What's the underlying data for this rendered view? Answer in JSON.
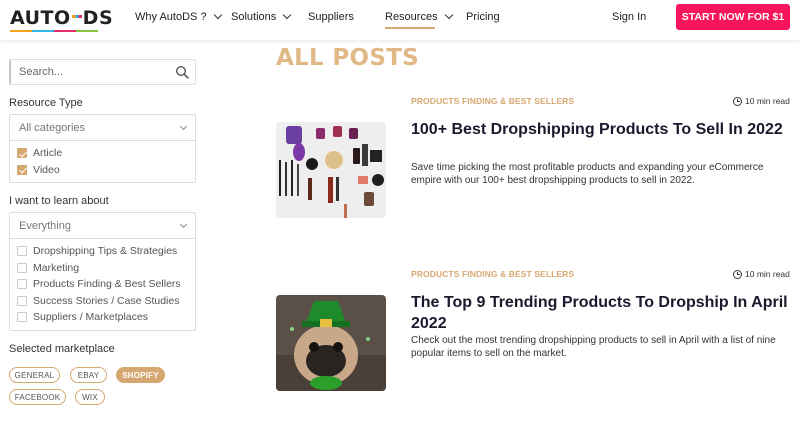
{
  "header": {
    "logo": {
      "left": "AUTO",
      "right": "DS"
    },
    "nav": [
      {
        "label": "Why AutoDS ?",
        "has_dropdown": true
      },
      {
        "label": "Solutions",
        "has_dropdown": true
      },
      {
        "label": "Suppliers",
        "has_dropdown": false
      },
      {
        "label": "Resources",
        "has_dropdown": true,
        "active": true
      },
      {
        "label": "Pricing",
        "has_dropdown": false
      }
    ],
    "signin": "Sign In",
    "cta": "START NOW FOR $1"
  },
  "sidebar": {
    "search_placeholder": "Search...",
    "resource_type": {
      "label": "Resource Type",
      "select": "All categories",
      "options": [
        {
          "label": "Article",
          "checked": true
        },
        {
          "label": "Video",
          "checked": true
        }
      ]
    },
    "learn": {
      "label": "I want to learn about",
      "select": "Everything",
      "options": [
        {
          "label": "Dropshipping Tips & Strategies",
          "checked": false
        },
        {
          "label": "Marketing",
          "checked": false
        },
        {
          "label": "Products Finding & Best Sellers",
          "checked": false
        },
        {
          "label": "Success Stories / Case Studies",
          "checked": false
        },
        {
          "label": "Suppliers / Marketplaces",
          "checked": false
        }
      ]
    },
    "marketplace": {
      "label": "Selected marketplace",
      "tags": [
        {
          "label": "GENERAL",
          "active": false
        },
        {
          "label": "EBAY",
          "active": false
        },
        {
          "label": "SHOPIFY",
          "active": true
        },
        {
          "label": "FACEBOOK",
          "active": false
        },
        {
          "label": "WIX",
          "active": false
        }
      ]
    }
  },
  "main": {
    "title": "ALL POSTS",
    "posts": [
      {
        "category": "PRODUCTS FINDING & BEST SELLERS",
        "read_time": "10 min read",
        "title": "100+ Best Dropshipping Products To Sell In 2022",
        "excerpt": "Save time picking the most profitable products and expanding your eCommerce empire with our 100+ best dropshipping products to sell in 2022."
      },
      {
        "category": "PRODUCTS FINDING & BEST SELLERS",
        "read_time": "10 min read",
        "title": "The Top 9 Trending Products To Dropship In April 2022",
        "excerpt": "Check out the most trending dropshipping products to sell in April with a list of nine popular items to sell on the market."
      }
    ]
  },
  "colors": {
    "accent": "#d6a871",
    "cta": "#f7155d",
    "title": "#e0b987"
  },
  "icons": [
    "search-icon",
    "chevron-down-icon",
    "clock-icon",
    "checkbox-icon"
  ]
}
